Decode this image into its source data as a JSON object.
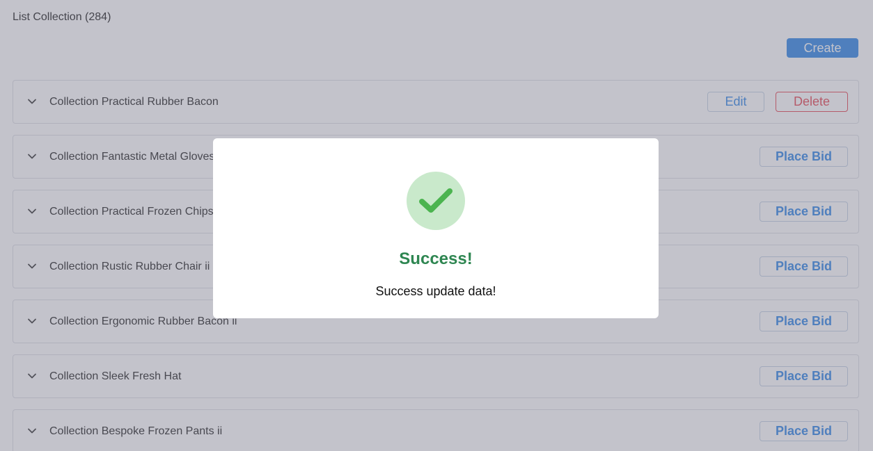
{
  "header": {
    "title": "List Collection (284)",
    "create_label": "Create"
  },
  "collections": [
    {
      "name": "Collection Practical Rubber Bacon",
      "owned": true,
      "edit_label": "Edit",
      "delete_label": "Delete"
    },
    {
      "name": "Collection Fantastic Metal Gloves",
      "owned": false,
      "bid_label": "Place Bid"
    },
    {
      "name": "Collection Practical Frozen Chips",
      "owned": false,
      "bid_label": "Place Bid"
    },
    {
      "name": "Collection Rustic Rubber Chair ii",
      "owned": false,
      "bid_label": "Place Bid"
    },
    {
      "name": "Collection Ergonomic Rubber Bacon ii",
      "owned": false,
      "bid_label": "Place Bid"
    },
    {
      "name": "Collection Sleek Fresh Hat",
      "owned": false,
      "bid_label": "Place Bid"
    },
    {
      "name": "Collection Bespoke Frozen Pants ii",
      "owned": false,
      "bid_label": "Place Bid"
    }
  ],
  "modal": {
    "icon": "check-icon",
    "title": "Success!",
    "message": "Success update data!"
  },
  "colors": {
    "primary": "#3f8ee8",
    "danger": "#e8525e",
    "success": "#2e8651",
    "success_icon": "#4bb44f",
    "success_icon_bg": "#c9e9cb"
  }
}
